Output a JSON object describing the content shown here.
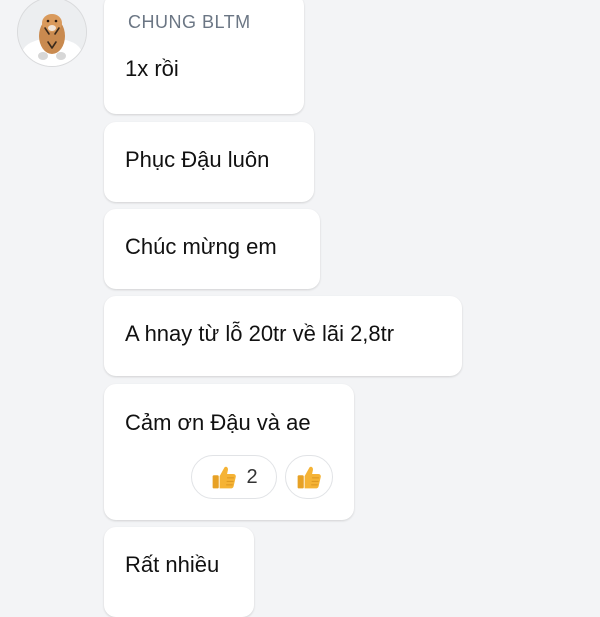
{
  "sender": {
    "name": "CHUNG BLTM",
    "avatar_icon": "tiger-avatar-icon"
  },
  "messages": [
    {
      "text": "1x rồi"
    },
    {
      "text": "Phục Đậu luôn"
    },
    {
      "text": "Chúc mừng em"
    },
    {
      "text": "A hnay từ lỗ 20tr về lãi 2,8tr"
    },
    {
      "text": "Cảm ơn Đậu và ae"
    },
    {
      "text": "Rất nhiều"
    }
  ],
  "reactions": [
    {
      "icon": "thumbs-up-icon",
      "count": "2"
    },
    {
      "icon": "thumbs-up-icon"
    }
  ],
  "colors": {
    "background": "#f3f4f6",
    "bubble": "#ffffff",
    "sender_name": "#6b7684",
    "thumb": "#f5b335"
  }
}
